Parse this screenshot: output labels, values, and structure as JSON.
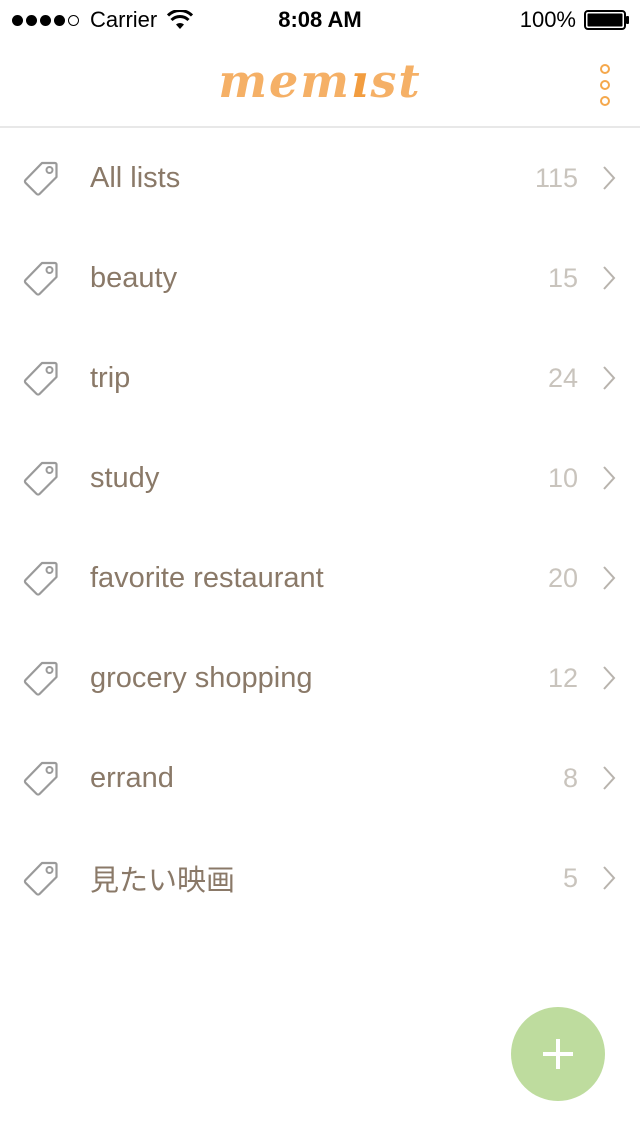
{
  "status_bar": {
    "carrier": "Carrier",
    "time": "8:08 AM",
    "battery": "100%"
  },
  "header": {
    "logo_parts": [
      "mem",
      "ı",
      "st"
    ],
    "menu_icon": "more-vertical-icon"
  },
  "colors": {
    "accent": "#f5a84c",
    "label": "#8a7968",
    "count": "#c9c4bd",
    "fab": "#bedc9e"
  },
  "lists": [
    {
      "label": "All lists",
      "count": "115"
    },
    {
      "label": "beauty",
      "count": "15"
    },
    {
      "label": "trip",
      "count": "24"
    },
    {
      "label": "study",
      "count": "10"
    },
    {
      "label": "favorite restaurant",
      "count": "20"
    },
    {
      "label": "grocery shopping",
      "count": "12"
    },
    {
      "label": "errand",
      "count": "8"
    },
    {
      "label": "見たい映画",
      "count": "5"
    }
  ],
  "fab": {
    "icon": "plus-icon"
  }
}
